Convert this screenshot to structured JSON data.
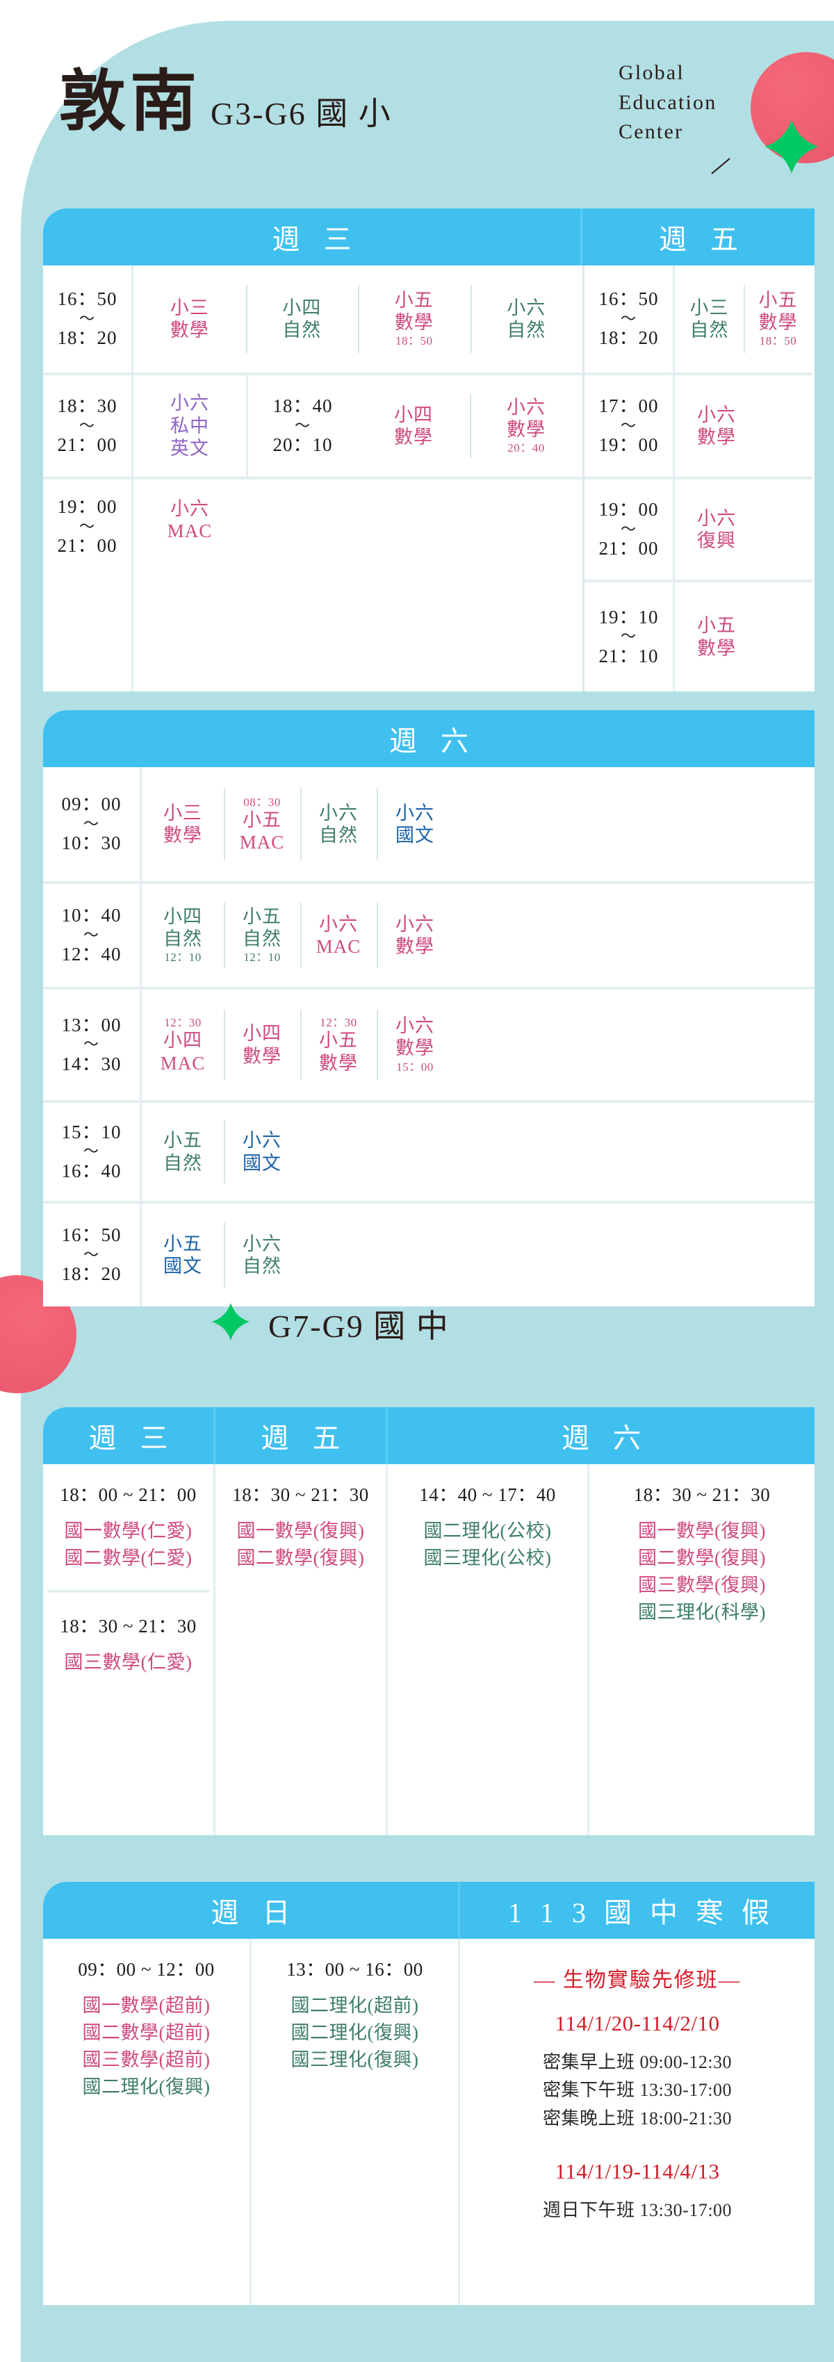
{
  "header": {
    "brand_cn": "敦南",
    "brand_grade": "G3-G6 國 小",
    "gec_line1": "Global",
    "gec_line2": "Education",
    "gec_line3": "Center"
  },
  "colors": {
    "bg_panel": "#b2dfe4",
    "header_blue": "#3fc0ef",
    "pink": "#cf4a7e",
    "green": "#3f7d6c",
    "purple": "#8f63c7",
    "blue": "#1a61a8",
    "red": "#d61b28",
    "deco_red": "#e8566b",
    "deco_green": "#00c964"
  },
  "elementary": {
    "table1": {
      "headers": [
        "週 三",
        "週 五"
      ],
      "wed": [
        {
          "time_start": "16：50",
          "time_end": "18：20",
          "classes": [
            {
              "name1": "小三",
              "name2": "數學",
              "color": "c-pink"
            },
            {
              "name1": "小四",
              "name2": "自然",
              "color": "c-green"
            },
            {
              "name1": "小五",
              "name2": "數學",
              "sub_bottom": "18：50",
              "color": "c-pink"
            },
            {
              "name1": "小六",
              "name2": "自然",
              "color": "c-green"
            }
          ]
        },
        {
          "time_start": "18：30",
          "time_end": "21：00",
          "classes": [
            {
              "name1": "小六",
              "name2": "私中",
              "name3": "英文",
              "color": "c-purple"
            }
          ],
          "inner_time_start": "18：40",
          "inner_time_end": "20：10",
          "inner_classes": [
            {
              "name1": "小四",
              "name2": "數學",
              "color": "c-pink"
            },
            {
              "name1": "小六",
              "name2": "數學",
              "sub_bottom": "20：40",
              "color": "c-pink"
            }
          ]
        },
        {
          "time_start": "19：00",
          "time_end": "21：00",
          "classes": [
            {
              "name1": "小六",
              "name2": "MAC",
              "color": "c-pink"
            }
          ]
        }
      ],
      "fri": [
        {
          "time_start": "16：50",
          "time_end": "18：20",
          "classes": [
            {
              "name1": "小三",
              "name2": "自然",
              "color": "c-green"
            },
            {
              "name1": "小五",
              "name2": "數學",
              "sub_bottom": "18：50",
              "color": "c-pink"
            }
          ]
        },
        {
          "time_start": "17：00",
          "time_end": "19：00",
          "classes": [
            {
              "name1": "小六",
              "name2": "數學",
              "color": "c-pink"
            }
          ]
        },
        {
          "time_start": "19：00",
          "time_end": "21：00",
          "classes": [
            {
              "name1": "小六",
              "name2": "復興",
              "color": "c-pink"
            }
          ]
        },
        {
          "time_start": "19：10",
          "time_end": "21：10",
          "classes": [
            {
              "name1": "小五",
              "name2": "數學",
              "color": "c-pink"
            }
          ]
        }
      ]
    },
    "table2": {
      "header": "週 六",
      "rows": [
        {
          "time_start": "09：00",
          "time_end": "10：30",
          "classes": [
            {
              "name1": "小三",
              "name2": "數學",
              "color": "c-pink"
            },
            {
              "sub_top": "08：30",
              "name1": "小五",
              "name2": "MAC",
              "color": "c-pink"
            },
            {
              "name1": "小六",
              "name2": "自然",
              "color": "c-green"
            },
            {
              "name1": "小六",
              "name2": "國文",
              "color": "c-blue"
            }
          ]
        },
        {
          "time_start": "10：40",
          "time_end": "12：40",
          "classes": [
            {
              "name1": "小四",
              "name2": "自然",
              "sub_bottom": "12：10",
              "color": "c-green"
            },
            {
              "name1": "小五",
              "name2": "自然",
              "sub_bottom": "12：10",
              "color": "c-green"
            },
            {
              "name1": "小六",
              "name2": "MAC",
              "color": "c-pink"
            },
            {
              "name1": "小六",
              "name2": "數學",
              "color": "c-pink"
            }
          ]
        },
        {
          "time_start": "13：00",
          "time_end": "14：30",
          "classes": [
            {
              "sub_top": "12：30",
              "name1": "小四",
              "name2": "MAC",
              "color": "c-pink"
            },
            {
              "name1": "小四",
              "name2": "數學",
              "color": "c-pink"
            },
            {
              "sub_top": "12：30",
              "name1": "小五",
              "name2": "數學",
              "color": "c-pink"
            },
            {
              "name1": "小六",
              "name2": "數學",
              "sub_bottom": "15：00",
              "color": "c-pink"
            }
          ]
        },
        {
          "time_start": "15：10",
          "time_end": "16：40",
          "classes": [
            {
              "name1": "小五",
              "name2": "自然",
              "color": "c-green"
            },
            {
              "name1": "小六",
              "name2": "國文",
              "color": "c-blue"
            }
          ]
        },
        {
          "time_start": "16：50",
          "time_end": "18：20",
          "classes": [
            {
              "name1": "小五",
              "name2": "國文",
              "color": "c-blue"
            },
            {
              "name1": "小六",
              "name2": "自然",
              "color": "c-green"
            }
          ]
        }
      ]
    }
  },
  "junior": {
    "section_title": "G7-G9 國 中",
    "table1": {
      "headers": [
        "週 三",
        "週 五",
        "週 六"
      ],
      "columns": [
        {
          "blocks": [
            {
              "time": "18：00 ~ 21：00",
              "items": [
                {
                  "text": "國一數學(仁愛)",
                  "color": "c-pink"
                },
                {
                  "text": "國二數學(仁愛)",
                  "color": "c-pink"
                }
              ]
            },
            {
              "time": "18：30 ~ 21：30",
              "items": [
                {
                  "text": "國三數學(仁愛)",
                  "color": "c-pink"
                }
              ]
            }
          ]
        },
        {
          "blocks": [
            {
              "time": "18：30 ~ 21：30",
              "items": [
                {
                  "text": "國一數學(復興)",
                  "color": "c-pink"
                },
                {
                  "text": "國二數學(復興)",
                  "color": "c-pink"
                }
              ]
            }
          ]
        },
        {
          "blocks": [
            {
              "time": "14：40 ~ 17：40",
              "items": [
                {
                  "text": "國二理化(公校)",
                  "color": "c-green"
                },
                {
                  "text": "國三理化(公校)",
                  "color": "c-green"
                }
              ]
            }
          ]
        },
        {
          "blocks": [
            {
              "time": "18：30 ~ 21：30",
              "items": [
                {
                  "text": "國一數學(復興)",
                  "color": "c-pink"
                },
                {
                  "text": "國二數學(復興)",
                  "color": "c-pink"
                },
                {
                  "text": "國三數學(復興)",
                  "color": "c-pink"
                },
                {
                  "text": "國三理化(科學)",
                  "color": "c-green"
                }
              ]
            }
          ]
        }
      ]
    },
    "table2": {
      "headers": [
        "週 日",
        "1 1 3 國 中 寒 假"
      ],
      "columns": [
        {
          "blocks": [
            {
              "time": "09：00 ~ 12：00",
              "items": [
                {
                  "text": "國一數學(超前)",
                  "color": "c-pink"
                },
                {
                  "text": "國二數學(超前)",
                  "color": "c-pink"
                },
                {
                  "text": "國三數學(超前)",
                  "color": "c-pink"
                },
                {
                  "text": "國二理化(復興)",
                  "color": "c-green"
                }
              ]
            }
          ]
        },
        {
          "blocks": [
            {
              "time": "13：00 ~ 16：00",
              "items": [
                {
                  "text": "國二理化(超前)",
                  "color": "c-green"
                },
                {
                  "text": "國二理化(復興)",
                  "color": "c-green"
                },
                {
                  "text": "國三理化(復興)",
                  "color": "c-green"
                }
              ]
            }
          ]
        }
      ],
      "camp": {
        "title": "— 生物實驗先修班—",
        "date1": "114/1/20-114/2/10",
        "line1": "密集早上班 09:00-12:30",
        "line2": "密集下午班 13:30-17:00",
        "line3": "密集晚上班 18:00-21:30",
        "date2": "114/1/19-114/4/13",
        "line4": "週日下午班 13:30-17:00"
      }
    }
  }
}
